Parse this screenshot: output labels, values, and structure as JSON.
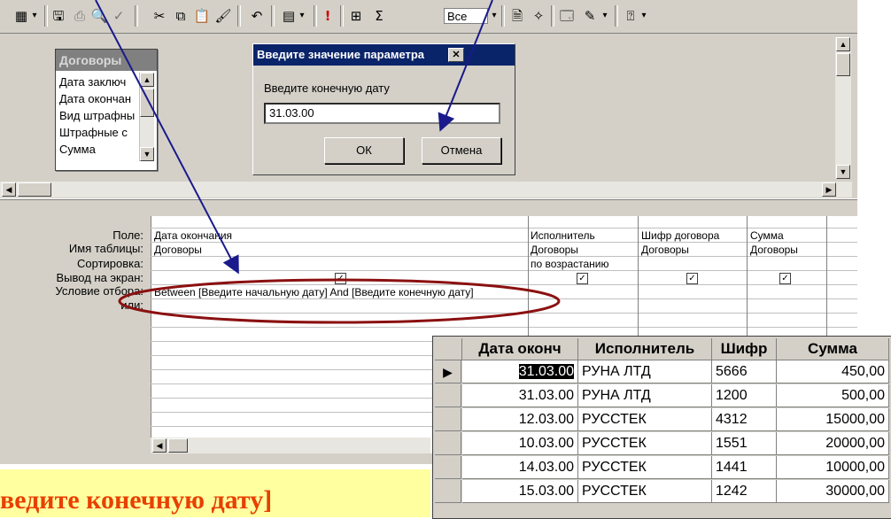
{
  "toolbar": {
    "all_combo": "Все",
    "sigma": "Σ",
    "exclamation": "!",
    "icons": [
      "view-icon",
      "save-icon",
      "print-icon",
      "preview-icon",
      "spell-icon",
      "cut-icon",
      "copy-icon",
      "paste-icon",
      "format-painter-icon",
      "undo-icon",
      "query-type-icon",
      "run-icon",
      "show-table-icon",
      "totals-icon",
      "properties-icon",
      "build-icon",
      "database-window-icon",
      "new-object-icon",
      "help-icon"
    ]
  },
  "table_list": {
    "title": "Договоры",
    "fields": [
      "Дата заключ",
      "Дата окончан",
      "Вид штрафны",
      "Штрафные с",
      "Сумма"
    ]
  },
  "dialog": {
    "title": "Введите значение параметра",
    "prompt": "Введите конечную дату",
    "value": "31.03.00",
    "ok": "ОК",
    "cancel": "Отмена"
  },
  "grid": {
    "row_labels": [
      "Поле:",
      "Имя таблицы:",
      "Сортировка:",
      "Вывод на экран:",
      "Условие отбора:",
      "или:"
    ],
    "columns": [
      {
        "field": "Дата окончания",
        "table": "Договоры",
        "sort": "",
        "show": true,
        "criteria": "Between [Введите начальную дату] And [Введите конечную дату]"
      },
      {
        "field": "Исполнитель",
        "table": "Договоры",
        "sort": "по возрастанию",
        "show": true,
        "criteria": ""
      },
      {
        "field": "Шифр договора",
        "table": "Договоры",
        "sort": "",
        "show": true,
        "criteria": ""
      },
      {
        "field": "Сумма",
        "table": "Договоры",
        "sort": "",
        "show": true,
        "criteria": ""
      }
    ]
  },
  "caption": "ведите конечную дату]",
  "result": {
    "headers": [
      "Дата оконч",
      "Исполнитель",
      "Шифр",
      "Сумма"
    ],
    "rows": [
      [
        "31.03.00",
        "РУНА ЛТД",
        "5666",
        "450,00"
      ],
      [
        "31.03.00",
        "РУНА ЛТД",
        "1200",
        "500,00"
      ],
      [
        "12.03.00",
        "РУССТЕК",
        "4312",
        "15000,00"
      ],
      [
        "10.03.00",
        "РУССТЕК",
        "1551",
        "20000,00"
      ],
      [
        "14.03.00",
        "РУССТЕК",
        "1441",
        "10000,00"
      ],
      [
        "15.03.00",
        "РУССТЕК",
        "1242",
        "30000,00"
      ]
    ],
    "current_row_marker": "▶"
  },
  "colors": {
    "title_bar": "#0a246a",
    "annotation_arrow": "#1a1a8c",
    "highlight_ellipse": "#8b1010",
    "caption_text": "#e84000",
    "caption_bg": "#ffffa0"
  }
}
